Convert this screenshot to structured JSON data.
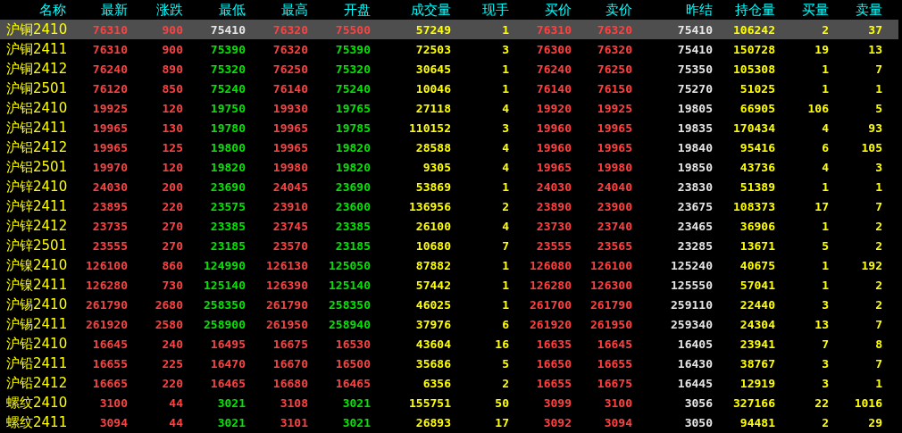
{
  "columns": [
    "名称",
    "最新",
    "涨跌",
    "最低",
    "最高",
    "开盘",
    "成交量",
    "现手",
    "买价",
    "卖价",
    "昨结",
    "持仓量",
    "买量",
    "卖量"
  ],
  "rows": [
    {
      "name": "沪铜2410",
      "selected": true,
      "cells": [
        {
          "text": "76310",
          "color": "#ff4040"
        },
        {
          "text": "900",
          "color": "#ff4040"
        },
        {
          "text": "75410",
          "color": "#e6e6e6"
        },
        {
          "text": "76320",
          "color": "#ff4040"
        },
        {
          "text": "75500",
          "color": "#ff4040"
        },
        {
          "text": "57249",
          "color": "#ffff00"
        },
        {
          "text": "1",
          "color": "#ffff00"
        },
        {
          "text": "76310",
          "color": "#ff4040"
        },
        {
          "text": "76320",
          "color": "#ff4040"
        },
        {
          "text": "75410",
          "color": "#e6e6e6"
        },
        {
          "text": "106242",
          "color": "#ffff00"
        },
        {
          "text": "2",
          "color": "#ffff00"
        },
        {
          "text": "37",
          "color": "#ffff00"
        }
      ]
    },
    {
      "name": "沪铜2411",
      "selected": false,
      "cells": [
        {
          "text": "76310",
          "color": "#ff4040"
        },
        {
          "text": "900",
          "color": "#ff4040"
        },
        {
          "text": "75390",
          "color": "#00e600"
        },
        {
          "text": "76320",
          "color": "#ff4040"
        },
        {
          "text": "75390",
          "color": "#00e600"
        },
        {
          "text": "72503",
          "color": "#ffff00"
        },
        {
          "text": "3",
          "color": "#ffff00"
        },
        {
          "text": "76300",
          "color": "#ff4040"
        },
        {
          "text": "76320",
          "color": "#ff4040"
        },
        {
          "text": "75410",
          "color": "#e6e6e6"
        },
        {
          "text": "150728",
          "color": "#ffff00"
        },
        {
          "text": "19",
          "color": "#ffff00"
        },
        {
          "text": "13",
          "color": "#ffff00"
        }
      ]
    },
    {
      "name": "沪铜2412",
      "selected": false,
      "cells": [
        {
          "text": "76240",
          "color": "#ff4040"
        },
        {
          "text": "890",
          "color": "#ff4040"
        },
        {
          "text": "75320",
          "color": "#00e600"
        },
        {
          "text": "76250",
          "color": "#ff4040"
        },
        {
          "text": "75320",
          "color": "#00e600"
        },
        {
          "text": "30645",
          "color": "#ffff00"
        },
        {
          "text": "1",
          "color": "#ffff00"
        },
        {
          "text": "76240",
          "color": "#ff4040"
        },
        {
          "text": "76250",
          "color": "#ff4040"
        },
        {
          "text": "75350",
          "color": "#e6e6e6"
        },
        {
          "text": "105308",
          "color": "#ffff00"
        },
        {
          "text": "1",
          "color": "#ffff00"
        },
        {
          "text": "7",
          "color": "#ffff00"
        }
      ]
    },
    {
      "name": "沪铜2501",
      "selected": false,
      "cells": [
        {
          "text": "76120",
          "color": "#ff4040"
        },
        {
          "text": "850",
          "color": "#ff4040"
        },
        {
          "text": "75240",
          "color": "#00e600"
        },
        {
          "text": "76140",
          "color": "#ff4040"
        },
        {
          "text": "75240",
          "color": "#00e600"
        },
        {
          "text": "10046",
          "color": "#ffff00"
        },
        {
          "text": "1",
          "color": "#ffff00"
        },
        {
          "text": "76140",
          "color": "#ff4040"
        },
        {
          "text": "76150",
          "color": "#ff4040"
        },
        {
          "text": "75270",
          "color": "#e6e6e6"
        },
        {
          "text": "51025",
          "color": "#ffff00"
        },
        {
          "text": "1",
          "color": "#ffff00"
        },
        {
          "text": "1",
          "color": "#ffff00"
        }
      ]
    },
    {
      "name": "沪铝2410",
      "selected": false,
      "cells": [
        {
          "text": "19925",
          "color": "#ff4040"
        },
        {
          "text": "120",
          "color": "#ff4040"
        },
        {
          "text": "19750",
          "color": "#00e600"
        },
        {
          "text": "19930",
          "color": "#ff4040"
        },
        {
          "text": "19765",
          "color": "#00e600"
        },
        {
          "text": "27118",
          "color": "#ffff00"
        },
        {
          "text": "4",
          "color": "#ffff00"
        },
        {
          "text": "19920",
          "color": "#ff4040"
        },
        {
          "text": "19925",
          "color": "#ff4040"
        },
        {
          "text": "19805",
          "color": "#e6e6e6"
        },
        {
          "text": "66905",
          "color": "#ffff00"
        },
        {
          "text": "106",
          "color": "#ffff00"
        },
        {
          "text": "5",
          "color": "#ffff00"
        }
      ]
    },
    {
      "name": "沪铝2411",
      "selected": false,
      "cells": [
        {
          "text": "19965",
          "color": "#ff4040"
        },
        {
          "text": "130",
          "color": "#ff4040"
        },
        {
          "text": "19780",
          "color": "#00e600"
        },
        {
          "text": "19965",
          "color": "#ff4040"
        },
        {
          "text": "19785",
          "color": "#00e600"
        },
        {
          "text": "110152",
          "color": "#ffff00"
        },
        {
          "text": "3",
          "color": "#ffff00"
        },
        {
          "text": "19960",
          "color": "#ff4040"
        },
        {
          "text": "19965",
          "color": "#ff4040"
        },
        {
          "text": "19835",
          "color": "#e6e6e6"
        },
        {
          "text": "170434",
          "color": "#ffff00"
        },
        {
          "text": "4",
          "color": "#ffff00"
        },
        {
          "text": "93",
          "color": "#ffff00"
        }
      ]
    },
    {
      "name": "沪铝2412",
      "selected": false,
      "cells": [
        {
          "text": "19965",
          "color": "#ff4040"
        },
        {
          "text": "125",
          "color": "#ff4040"
        },
        {
          "text": "19800",
          "color": "#00e600"
        },
        {
          "text": "19965",
          "color": "#ff4040"
        },
        {
          "text": "19820",
          "color": "#00e600"
        },
        {
          "text": "28588",
          "color": "#ffff00"
        },
        {
          "text": "4",
          "color": "#ffff00"
        },
        {
          "text": "19960",
          "color": "#ff4040"
        },
        {
          "text": "19965",
          "color": "#ff4040"
        },
        {
          "text": "19840",
          "color": "#e6e6e6"
        },
        {
          "text": "95416",
          "color": "#ffff00"
        },
        {
          "text": "6",
          "color": "#ffff00"
        },
        {
          "text": "105",
          "color": "#ffff00"
        }
      ]
    },
    {
      "name": "沪铝2501",
      "selected": false,
      "cells": [
        {
          "text": "19970",
          "color": "#ff4040"
        },
        {
          "text": "120",
          "color": "#ff4040"
        },
        {
          "text": "19820",
          "color": "#00e600"
        },
        {
          "text": "19980",
          "color": "#ff4040"
        },
        {
          "text": "19820",
          "color": "#00e600"
        },
        {
          "text": "9305",
          "color": "#ffff00"
        },
        {
          "text": "4",
          "color": "#ffff00"
        },
        {
          "text": "19965",
          "color": "#ff4040"
        },
        {
          "text": "19980",
          "color": "#ff4040"
        },
        {
          "text": "19850",
          "color": "#e6e6e6"
        },
        {
          "text": "43736",
          "color": "#ffff00"
        },
        {
          "text": "4",
          "color": "#ffff00"
        },
        {
          "text": "3",
          "color": "#ffff00"
        }
      ]
    },
    {
      "name": "沪锌2410",
      "selected": false,
      "cells": [
        {
          "text": "24030",
          "color": "#ff4040"
        },
        {
          "text": "200",
          "color": "#ff4040"
        },
        {
          "text": "23690",
          "color": "#00e600"
        },
        {
          "text": "24045",
          "color": "#ff4040"
        },
        {
          "text": "23690",
          "color": "#00e600"
        },
        {
          "text": "53869",
          "color": "#ffff00"
        },
        {
          "text": "1",
          "color": "#ffff00"
        },
        {
          "text": "24030",
          "color": "#ff4040"
        },
        {
          "text": "24040",
          "color": "#ff4040"
        },
        {
          "text": "23830",
          "color": "#e6e6e6"
        },
        {
          "text": "51389",
          "color": "#ffff00"
        },
        {
          "text": "1",
          "color": "#ffff00"
        },
        {
          "text": "1",
          "color": "#ffff00"
        }
      ]
    },
    {
      "name": "沪锌2411",
      "selected": false,
      "cells": [
        {
          "text": "23895",
          "color": "#ff4040"
        },
        {
          "text": "220",
          "color": "#ff4040"
        },
        {
          "text": "23575",
          "color": "#00e600"
        },
        {
          "text": "23910",
          "color": "#ff4040"
        },
        {
          "text": "23600",
          "color": "#00e600"
        },
        {
          "text": "136956",
          "color": "#ffff00"
        },
        {
          "text": "2",
          "color": "#ffff00"
        },
        {
          "text": "23890",
          "color": "#ff4040"
        },
        {
          "text": "23900",
          "color": "#ff4040"
        },
        {
          "text": "23675",
          "color": "#e6e6e6"
        },
        {
          "text": "108373",
          "color": "#ffff00"
        },
        {
          "text": "17",
          "color": "#ffff00"
        },
        {
          "text": "7",
          "color": "#ffff00"
        }
      ]
    },
    {
      "name": "沪锌2412",
      "selected": false,
      "cells": [
        {
          "text": "23735",
          "color": "#ff4040"
        },
        {
          "text": "270",
          "color": "#ff4040"
        },
        {
          "text": "23385",
          "color": "#00e600"
        },
        {
          "text": "23745",
          "color": "#ff4040"
        },
        {
          "text": "23385",
          "color": "#00e600"
        },
        {
          "text": "26100",
          "color": "#ffff00"
        },
        {
          "text": "4",
          "color": "#ffff00"
        },
        {
          "text": "23730",
          "color": "#ff4040"
        },
        {
          "text": "23740",
          "color": "#ff4040"
        },
        {
          "text": "23465",
          "color": "#e6e6e6"
        },
        {
          "text": "36906",
          "color": "#ffff00"
        },
        {
          "text": "1",
          "color": "#ffff00"
        },
        {
          "text": "2",
          "color": "#ffff00"
        }
      ]
    },
    {
      "name": "沪锌2501",
      "selected": false,
      "cells": [
        {
          "text": "23555",
          "color": "#ff4040"
        },
        {
          "text": "270",
          "color": "#ff4040"
        },
        {
          "text": "23185",
          "color": "#00e600"
        },
        {
          "text": "23570",
          "color": "#ff4040"
        },
        {
          "text": "23185",
          "color": "#00e600"
        },
        {
          "text": "10680",
          "color": "#ffff00"
        },
        {
          "text": "7",
          "color": "#ffff00"
        },
        {
          "text": "23555",
          "color": "#ff4040"
        },
        {
          "text": "23565",
          "color": "#ff4040"
        },
        {
          "text": "23285",
          "color": "#e6e6e6"
        },
        {
          "text": "13671",
          "color": "#ffff00"
        },
        {
          "text": "5",
          "color": "#ffff00"
        },
        {
          "text": "2",
          "color": "#ffff00"
        }
      ]
    },
    {
      "name": "沪镍2410",
      "selected": false,
      "cells": [
        {
          "text": "126100",
          "color": "#ff4040"
        },
        {
          "text": "860",
          "color": "#ff4040"
        },
        {
          "text": "124990",
          "color": "#00e600"
        },
        {
          "text": "126130",
          "color": "#ff4040"
        },
        {
          "text": "125050",
          "color": "#00e600"
        },
        {
          "text": "87882",
          "color": "#ffff00"
        },
        {
          "text": "1",
          "color": "#ffff00"
        },
        {
          "text": "126080",
          "color": "#ff4040"
        },
        {
          "text": "126100",
          "color": "#ff4040"
        },
        {
          "text": "125240",
          "color": "#e6e6e6"
        },
        {
          "text": "40675",
          "color": "#ffff00"
        },
        {
          "text": "1",
          "color": "#ffff00"
        },
        {
          "text": "192",
          "color": "#ffff00"
        }
      ]
    },
    {
      "name": "沪镍2411",
      "selected": false,
      "cells": [
        {
          "text": "126280",
          "color": "#ff4040"
        },
        {
          "text": "730",
          "color": "#ff4040"
        },
        {
          "text": "125140",
          "color": "#00e600"
        },
        {
          "text": "126390",
          "color": "#ff4040"
        },
        {
          "text": "125140",
          "color": "#00e600"
        },
        {
          "text": "57442",
          "color": "#ffff00"
        },
        {
          "text": "1",
          "color": "#ffff00"
        },
        {
          "text": "126280",
          "color": "#ff4040"
        },
        {
          "text": "126300",
          "color": "#ff4040"
        },
        {
          "text": "125550",
          "color": "#e6e6e6"
        },
        {
          "text": "57041",
          "color": "#ffff00"
        },
        {
          "text": "1",
          "color": "#ffff00"
        },
        {
          "text": "2",
          "color": "#ffff00"
        }
      ]
    },
    {
      "name": "沪锡2410",
      "selected": false,
      "cells": [
        {
          "text": "261790",
          "color": "#ff4040"
        },
        {
          "text": "2680",
          "color": "#ff4040"
        },
        {
          "text": "258350",
          "color": "#00e600"
        },
        {
          "text": "261790",
          "color": "#ff4040"
        },
        {
          "text": "258350",
          "color": "#00e600"
        },
        {
          "text": "46025",
          "color": "#ffff00"
        },
        {
          "text": "1",
          "color": "#ffff00"
        },
        {
          "text": "261700",
          "color": "#ff4040"
        },
        {
          "text": "261790",
          "color": "#ff4040"
        },
        {
          "text": "259110",
          "color": "#e6e6e6"
        },
        {
          "text": "22440",
          "color": "#ffff00"
        },
        {
          "text": "3",
          "color": "#ffff00"
        },
        {
          "text": "2",
          "color": "#ffff00"
        }
      ]
    },
    {
      "name": "沪锡2411",
      "selected": false,
      "cells": [
        {
          "text": "261920",
          "color": "#ff4040"
        },
        {
          "text": "2580",
          "color": "#ff4040"
        },
        {
          "text": "258900",
          "color": "#00e600"
        },
        {
          "text": "261950",
          "color": "#ff4040"
        },
        {
          "text": "258940",
          "color": "#00e600"
        },
        {
          "text": "37976",
          "color": "#ffff00"
        },
        {
          "text": "6",
          "color": "#ffff00"
        },
        {
          "text": "261920",
          "color": "#ff4040"
        },
        {
          "text": "261950",
          "color": "#ff4040"
        },
        {
          "text": "259340",
          "color": "#e6e6e6"
        },
        {
          "text": "24304",
          "color": "#ffff00"
        },
        {
          "text": "13",
          "color": "#ffff00"
        },
        {
          "text": "7",
          "color": "#ffff00"
        }
      ]
    },
    {
      "name": "沪铅2410",
      "selected": false,
      "cells": [
        {
          "text": "16645",
          "color": "#ff4040"
        },
        {
          "text": "240",
          "color": "#ff4040"
        },
        {
          "text": "16495",
          "color": "#ff4040"
        },
        {
          "text": "16675",
          "color": "#ff4040"
        },
        {
          "text": "16530",
          "color": "#ff4040"
        },
        {
          "text": "43604",
          "color": "#ffff00"
        },
        {
          "text": "16",
          "color": "#ffff00"
        },
        {
          "text": "16635",
          "color": "#ff4040"
        },
        {
          "text": "16645",
          "color": "#ff4040"
        },
        {
          "text": "16405",
          "color": "#e6e6e6"
        },
        {
          "text": "23941",
          "color": "#ffff00"
        },
        {
          "text": "7",
          "color": "#ffff00"
        },
        {
          "text": "8",
          "color": "#ffff00"
        }
      ]
    },
    {
      "name": "沪铅2411",
      "selected": false,
      "cells": [
        {
          "text": "16655",
          "color": "#ff4040"
        },
        {
          "text": "225",
          "color": "#ff4040"
        },
        {
          "text": "16470",
          "color": "#ff4040"
        },
        {
          "text": "16670",
          "color": "#ff4040"
        },
        {
          "text": "16500",
          "color": "#ff4040"
        },
        {
          "text": "35686",
          "color": "#ffff00"
        },
        {
          "text": "5",
          "color": "#ffff00"
        },
        {
          "text": "16650",
          "color": "#ff4040"
        },
        {
          "text": "16655",
          "color": "#ff4040"
        },
        {
          "text": "16430",
          "color": "#e6e6e6"
        },
        {
          "text": "38767",
          "color": "#ffff00"
        },
        {
          "text": "3",
          "color": "#ffff00"
        },
        {
          "text": "7",
          "color": "#ffff00"
        }
      ]
    },
    {
      "name": "沪铅2412",
      "selected": false,
      "cells": [
        {
          "text": "16665",
          "color": "#ff4040"
        },
        {
          "text": "220",
          "color": "#ff4040"
        },
        {
          "text": "16465",
          "color": "#ff4040"
        },
        {
          "text": "16680",
          "color": "#ff4040"
        },
        {
          "text": "16465",
          "color": "#ff4040"
        },
        {
          "text": "6356",
          "color": "#ffff00"
        },
        {
          "text": "2",
          "color": "#ffff00"
        },
        {
          "text": "16655",
          "color": "#ff4040"
        },
        {
          "text": "16675",
          "color": "#ff4040"
        },
        {
          "text": "16445",
          "color": "#e6e6e6"
        },
        {
          "text": "12919",
          "color": "#ffff00"
        },
        {
          "text": "3",
          "color": "#ffff00"
        },
        {
          "text": "1",
          "color": "#ffff00"
        }
      ]
    },
    {
      "name": "螺纹2410",
      "selected": false,
      "cells": [
        {
          "text": "3100",
          "color": "#ff4040"
        },
        {
          "text": "44",
          "color": "#ff4040"
        },
        {
          "text": "3021",
          "color": "#00e600"
        },
        {
          "text": "3108",
          "color": "#ff4040"
        },
        {
          "text": "3021",
          "color": "#00e600"
        },
        {
          "text": "155751",
          "color": "#ffff00"
        },
        {
          "text": "50",
          "color": "#ffff00"
        },
        {
          "text": "3099",
          "color": "#ff4040"
        },
        {
          "text": "3100",
          "color": "#ff4040"
        },
        {
          "text": "3056",
          "color": "#e6e6e6"
        },
        {
          "text": "327166",
          "color": "#ffff00"
        },
        {
          "text": "22",
          "color": "#ffff00"
        },
        {
          "text": "1016",
          "color": "#ffff00"
        }
      ]
    },
    {
      "name": "螺纹2411",
      "selected": false,
      "cells": [
        {
          "text": "3094",
          "color": "#ff4040"
        },
        {
          "text": "44",
          "color": "#ff4040"
        },
        {
          "text": "3021",
          "color": "#00e600"
        },
        {
          "text": "3101",
          "color": "#ff4040"
        },
        {
          "text": "3021",
          "color": "#00e600"
        },
        {
          "text": "26893",
          "color": "#ffff00"
        },
        {
          "text": "17",
          "color": "#ffff00"
        },
        {
          "text": "3092",
          "color": "#ff4040"
        },
        {
          "text": "3094",
          "color": "#ff4040"
        },
        {
          "text": "3050",
          "color": "#e6e6e6"
        },
        {
          "text": "94481",
          "color": "#ffff00"
        },
        {
          "text": "2",
          "color": "#ffff00"
        },
        {
          "text": "29",
          "color": "#ffff00"
        }
      ]
    }
  ]
}
